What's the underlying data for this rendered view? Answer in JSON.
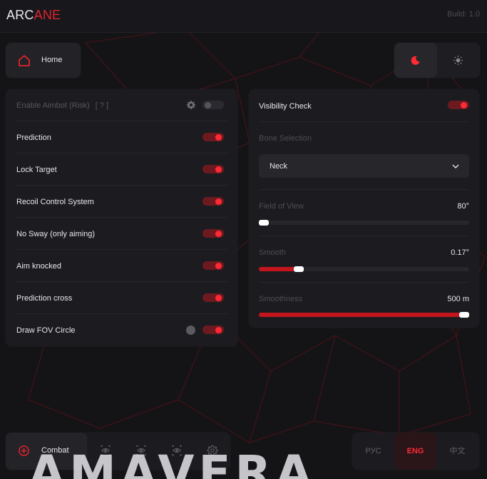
{
  "header": {
    "logo_part1": "ARC",
    "logo_part2": "ANE",
    "build": "Build: 1.0"
  },
  "nav": {
    "home_label": "Home",
    "home_icon": "home-icon",
    "theme_icons": [
      "moon-icon",
      "sun-icon"
    ],
    "active_theme": "dark"
  },
  "aimbot": {
    "items": [
      {
        "label": "Enable Aimbot (Risk)",
        "hint": "[ ? ]",
        "enabled": false,
        "disabled_style": true,
        "has_gear": true
      },
      {
        "label": "Prediction",
        "enabled": true
      },
      {
        "label": "Lock Target",
        "enabled": true
      },
      {
        "label": "Recoil Control System",
        "enabled": true
      },
      {
        "label": "No Sway (only aiming)",
        "enabled": true
      },
      {
        "label": "Aim knocked",
        "enabled": true
      },
      {
        "label": "Prediction cross",
        "enabled": true
      },
      {
        "label": "Draw FOV Circle",
        "enabled": true,
        "has_color_dot": true
      }
    ]
  },
  "settings": {
    "visibility_check_label": "Visibility Check",
    "visibility_check": true,
    "bone_selection_label": "Bone Selection",
    "bone_selected": "Neck",
    "fov_label": "Field of View",
    "fov_value": "80°",
    "fov_fraction": 0.02,
    "smooth_label": "Smooth",
    "smooth_value": "0.17°",
    "smooth_fraction": 0.19,
    "smoothness_label": "Smoothness",
    "smoothness_value": "500 m",
    "smoothness_fraction": 0.98
  },
  "footer": {
    "combat_label": "Combat",
    "combat_icon": "crosshair-icon",
    "tab_icons": [
      "eye-icon",
      "eye-icon",
      "eye-icon",
      "gear-icon"
    ],
    "languages": [
      "РУС",
      "ENG",
      "中文"
    ],
    "active_language": "ENG"
  },
  "watermark": "AMAVERA",
  "colors": {
    "accent": "#e0242d",
    "toggle_track_on": "#6c1a1f",
    "background": "#141417",
    "panel": "#1c1c20"
  }
}
